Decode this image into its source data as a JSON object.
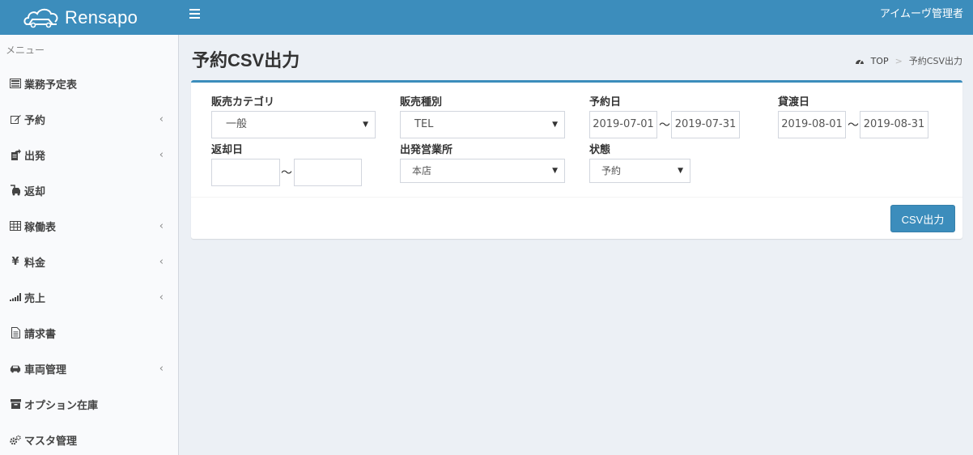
{
  "header": {
    "logo_text": "Rensapo",
    "user_name": "アイムーヴ管理者"
  },
  "sidebar": {
    "menu_header": "メニュー",
    "items": [
      {
        "label": "業務予定表",
        "icon": "list-alt-icon",
        "has_chevron": false
      },
      {
        "label": "予約",
        "icon": "edit-icon",
        "has_chevron": true
      },
      {
        "label": "出発",
        "icon": "share-document-icon",
        "has_chevron": true
      },
      {
        "label": "返却",
        "icon": "return-car-icon",
        "has_chevron": false
      },
      {
        "label": "稼働表",
        "icon": "table-icon",
        "has_chevron": true
      },
      {
        "label": "料金",
        "icon": "yen-icon",
        "has_chevron": true
      },
      {
        "label": "売上",
        "icon": "signal-icon",
        "has_chevron": true
      },
      {
        "label": "請求書",
        "icon": "file-text-icon",
        "has_chevron": false
      },
      {
        "label": "車両管理",
        "icon": "car-icon",
        "has_chevron": true
      },
      {
        "label": "オプション在庫",
        "icon": "archive-icon",
        "has_chevron": false
      },
      {
        "label": "マスタ管理",
        "icon": "cogs-icon",
        "has_chevron": false
      }
    ],
    "chevron": "‹"
  },
  "page": {
    "title": "予約CSV出力",
    "breadcrumb": {
      "home": "TOP",
      "separator": ">",
      "current": "予約CSV出力"
    }
  },
  "form": {
    "sales_category": {
      "label": "販売カテゴリ",
      "value": "一般"
    },
    "sales_type": {
      "label": "販売種別",
      "value": "TEL"
    },
    "reservation_date": {
      "label": "予約日",
      "from": "2019-07-01",
      "to": "2019-07-31"
    },
    "rental_date": {
      "label": "貸渡日",
      "from": "2019-08-01",
      "to": "2019-08-31"
    },
    "return_date": {
      "label": "返却日",
      "from": "",
      "to": ""
    },
    "departure_office": {
      "label": "出発営業所",
      "value": "本店"
    },
    "status": {
      "label": "状態",
      "value": "予約"
    },
    "tilde": "〜",
    "select_arrow": "▼"
  },
  "actions": {
    "csv_label": "CSV出力"
  },
  "colors": {
    "primary": "#3c8dbc",
    "background": "#ecf0f5",
    "sidebar": "#f9fafc"
  }
}
